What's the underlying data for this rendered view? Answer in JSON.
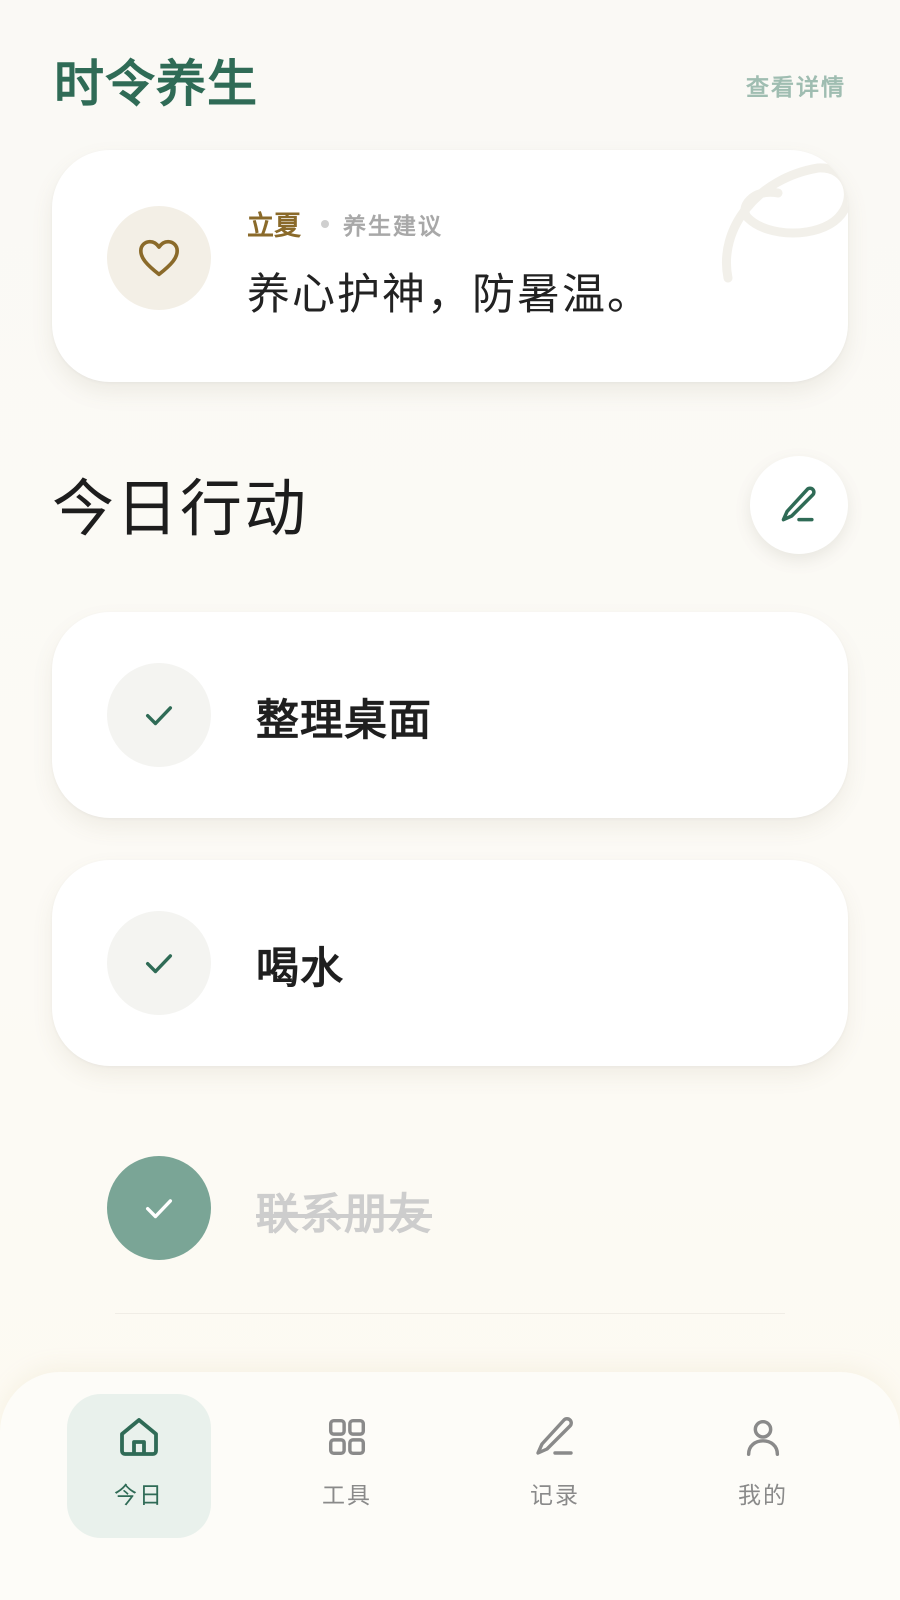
{
  "header": {
    "title": "时令养生",
    "details_link": "查看详情"
  },
  "advice": {
    "solar_term": "立夏",
    "label": "养生建议",
    "text": "养心护神，防暑温。",
    "icon": "heart-icon"
  },
  "section": {
    "title": "今日行动",
    "edit_icon": "pencil-icon"
  },
  "tasks": [
    {
      "label": "整理桌面",
      "completed": false
    },
    {
      "label": "喝水",
      "completed": false
    },
    {
      "label": "联系朋友",
      "completed": true
    }
  ],
  "nav": {
    "items": [
      {
        "label": "今日",
        "icon": "home-icon",
        "active": true
      },
      {
        "label": "工具",
        "icon": "grid-icon",
        "active": false
      },
      {
        "label": "记录",
        "icon": "pencil-icon",
        "active": false
      },
      {
        "label": "我的",
        "icon": "user-icon",
        "active": false
      }
    ]
  },
  "colors": {
    "brand_green": "#2f6b56",
    "accent_gold": "#8a6a2a",
    "done_green": "#7aa596",
    "background": "#faf9f5"
  }
}
